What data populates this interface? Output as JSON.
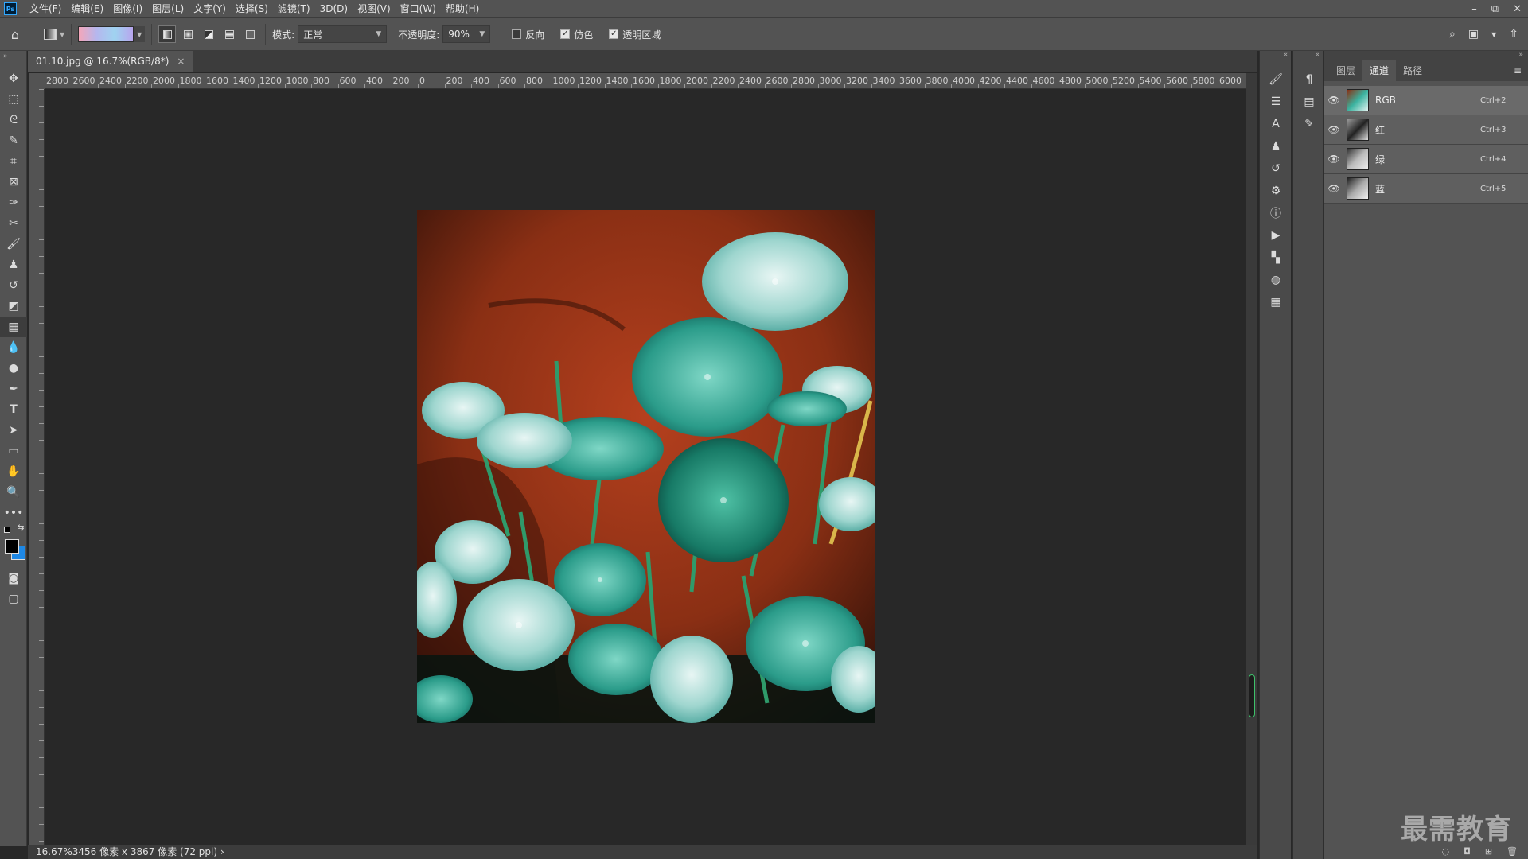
{
  "menu": [
    "文件(F)",
    "编辑(E)",
    "图像(I)",
    "图层(L)",
    "文字(Y)",
    "选择(S)",
    "滤镜(T)",
    "3D(D)",
    "视图(V)",
    "窗口(W)",
    "帮助(H)"
  ],
  "window_controls": {
    "minimize": "–",
    "restore": "⧉",
    "close": "✕"
  },
  "options": {
    "mode_label": "模式:",
    "mode_value": "正常",
    "opacity_label": "不透明度:",
    "opacity_value": "90%",
    "reverse_label": "反向",
    "reverse_checked": false,
    "dither_label": "仿色",
    "dither_checked": true,
    "transparency_label": "透明区域",
    "transparency_checked": true
  },
  "document": {
    "tab_title": "01.10.jpg @ 16.7%(RGB/8*)",
    "close_glyph": "×"
  },
  "ruler_top_labels": [
    "2800",
    "2600",
    "2400",
    "2200",
    "2000",
    "1800",
    "1600",
    "1400",
    "1200",
    "1000",
    "800",
    "600",
    "400",
    "200",
    "0",
    "200",
    "400",
    "600",
    "800",
    "1000",
    "1200",
    "1400",
    "1600",
    "1800",
    "2000",
    "2200",
    "2400",
    "2600",
    "2800",
    "3000",
    "3200",
    "3400",
    "3600",
    "3800",
    "4000",
    "4200",
    "4400",
    "4600",
    "4800",
    "5000",
    "5200",
    "5400",
    "5600",
    "5800",
    "6000",
    "6"
  ],
  "status": {
    "zoom": "16.67%",
    "info": "3456 像素 x 3867 像素 (72 ppi)"
  },
  "panel": {
    "tabs": [
      "图层",
      "通道",
      "路径"
    ],
    "active_tab": "通道",
    "channels": [
      {
        "name": "RGB",
        "shortcut": "Ctrl+2"
      },
      {
        "name": "红",
        "shortcut": "Ctrl+3"
      },
      {
        "name": "绿",
        "shortcut": "Ctrl+4"
      },
      {
        "name": "蓝",
        "shortcut": "Ctrl+5"
      }
    ]
  },
  "watermark": "最需教育",
  "colors": {
    "foreground": "#000000",
    "background": "#1e88e5",
    "accent": "#31a8ff"
  }
}
